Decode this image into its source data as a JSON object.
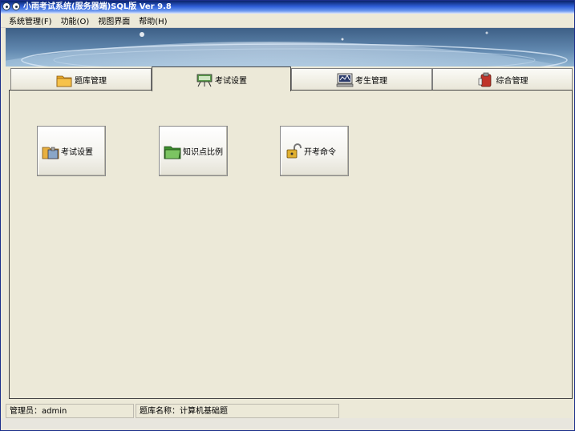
{
  "window": {
    "title": "小雨考试系统(服务器端)SQL版 Ver 9.8"
  },
  "menu": [
    {
      "label": "系统管理(F)"
    },
    {
      "label": "功能(O)"
    },
    {
      "label": "视图界面"
    },
    {
      "label": "帮助(H)"
    }
  ],
  "tabs": [
    {
      "label": "题库管理",
      "icon": "folder-icon"
    },
    {
      "label": "考试设置",
      "icon": "exam-setup-icon",
      "active": true
    },
    {
      "label": "考生管理",
      "icon": "monitor-icon"
    },
    {
      "label": "综合管理",
      "icon": "tools-icon"
    }
  ],
  "buttons": [
    {
      "label": "考试设置",
      "icon": "settings-icon"
    },
    {
      "label": "知识点比例",
      "icon": "green-folder-icon"
    },
    {
      "label": "开考命令",
      "icon": "unlock-icon"
    }
  ],
  "status": {
    "admin": "管理员：admin",
    "bank": "题库名称：计算机基础题"
  },
  "colors": {
    "title_bar": "#2f5fd8",
    "background": "#ece9d8",
    "banner": "#5f86ad"
  }
}
